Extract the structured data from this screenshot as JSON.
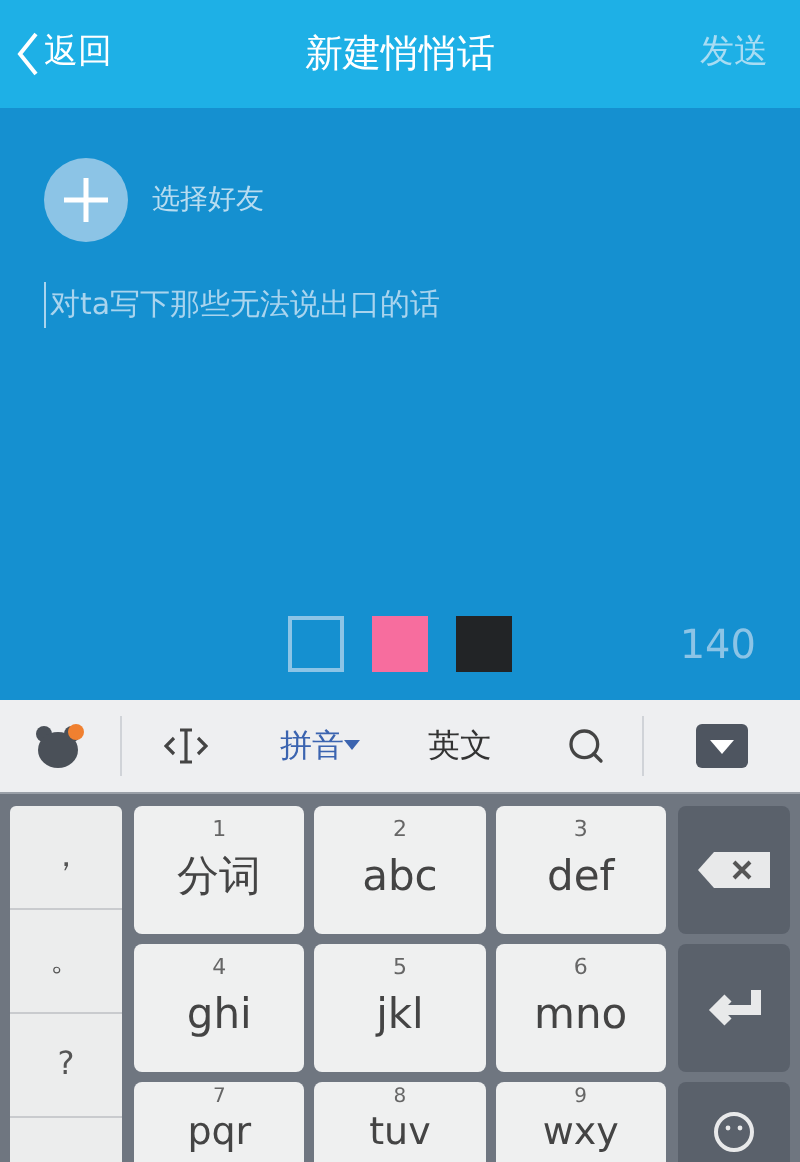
{
  "header": {
    "back": "返回",
    "title": "新建悄悄话",
    "send": "发送"
  },
  "compose": {
    "add_friend": "选择好友",
    "placeholder": "对ta写下那些无法说出口的话",
    "counter": "140"
  },
  "colors": [
    {
      "color": "#1590d0",
      "selected": true
    },
    {
      "color": "#f76d9e",
      "selected": false
    },
    {
      "color": "#222426",
      "selected": false
    }
  ],
  "ime_toolbar": {
    "pinyin": {
      "label": "拼音",
      "selected": true
    },
    "english": {
      "label": "英文",
      "selected": false
    }
  },
  "punctuation": [
    "，",
    "。",
    "?"
  ],
  "keys": [
    {
      "digit": "1",
      "label": "分词"
    },
    {
      "digit": "2",
      "label": "abc"
    },
    {
      "digit": "3",
      "label": "def"
    },
    {
      "digit": "4",
      "label": "ghi"
    },
    {
      "digit": "5",
      "label": "jkl"
    },
    {
      "digit": "6",
      "label": "mno"
    },
    {
      "digit": "7",
      "label": "pqr"
    },
    {
      "digit": "8",
      "label": "tuv"
    },
    {
      "digit": "9",
      "label": "wxy"
    }
  ]
}
